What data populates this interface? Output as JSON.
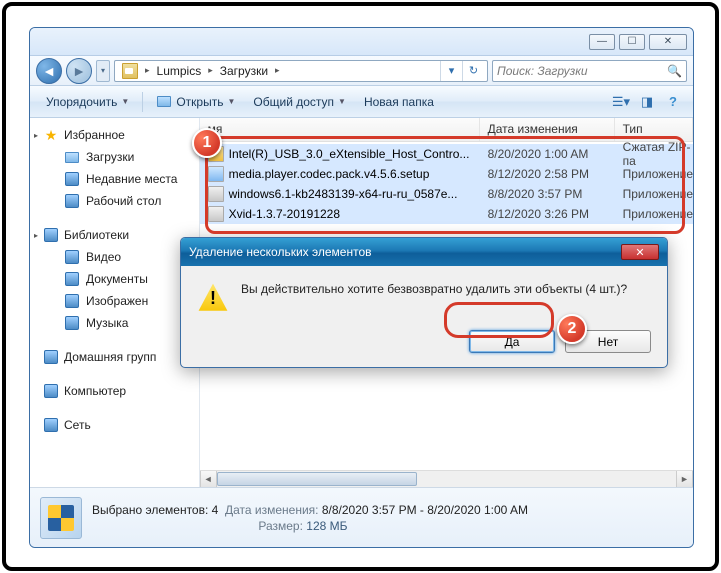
{
  "breadcrumb": {
    "seg1": "Lumpics",
    "seg2": "Загрузки"
  },
  "search": {
    "placeholder": "Поиск: Загрузки"
  },
  "toolbar": {
    "organize": "Упорядочить",
    "open": "Открыть",
    "share": "Общий доступ",
    "newfolder": "Новая папка"
  },
  "sidebar": {
    "favorites": "Избранное",
    "fav_items": [
      "Загрузки",
      "Недавние места",
      "Рабочий стол"
    ],
    "libraries": "Библиотеки",
    "lib_items": [
      "Видео",
      "Документы",
      "Изображен",
      "Музыка"
    ],
    "homegroup": "Домашняя групп",
    "computer": "Компьютер",
    "network": "Сеть"
  },
  "columns": {
    "name": "мя",
    "date": "Дата изменения",
    "type": "Тип"
  },
  "files": [
    {
      "name": "Intel(R)_USB_3.0_eXtensible_Host_Contro...",
      "date": "8/20/2020 1:00 AM",
      "type": "Сжатая ZIP-па",
      "ico": "zip"
    },
    {
      "name": "media.player.codec.pack.v4.5.6.setup",
      "date": "8/12/2020 2:58 PM",
      "type": "Приложение",
      "ico": "app"
    },
    {
      "name": "windows6.1-kb2483139-x64-ru-ru_0587e...",
      "date": "8/8/2020 3:57 PM",
      "type": "Приложение",
      "ico": "exe"
    },
    {
      "name": "Xvid-1.3.7-20191228",
      "date": "8/12/2020 3:26 PM",
      "type": "Приложение",
      "ico": "exe"
    }
  ],
  "status": {
    "line1_label": "Выбрано элементов: 4",
    "date_label": "Дата изменения:",
    "date_value": "8/8/2020 3:57 PM - 8/20/2020 1:00 AM",
    "size_label": "Размер:",
    "size_value": "128 МБ"
  },
  "dialog": {
    "title": "Удаление нескольких элементов",
    "message": "Вы действительно хотите безвозвратно удалить эти объекты (4 шт.)?",
    "yes": "Да",
    "no": "Нет"
  },
  "badges": {
    "b1": "1",
    "b2": "2"
  }
}
